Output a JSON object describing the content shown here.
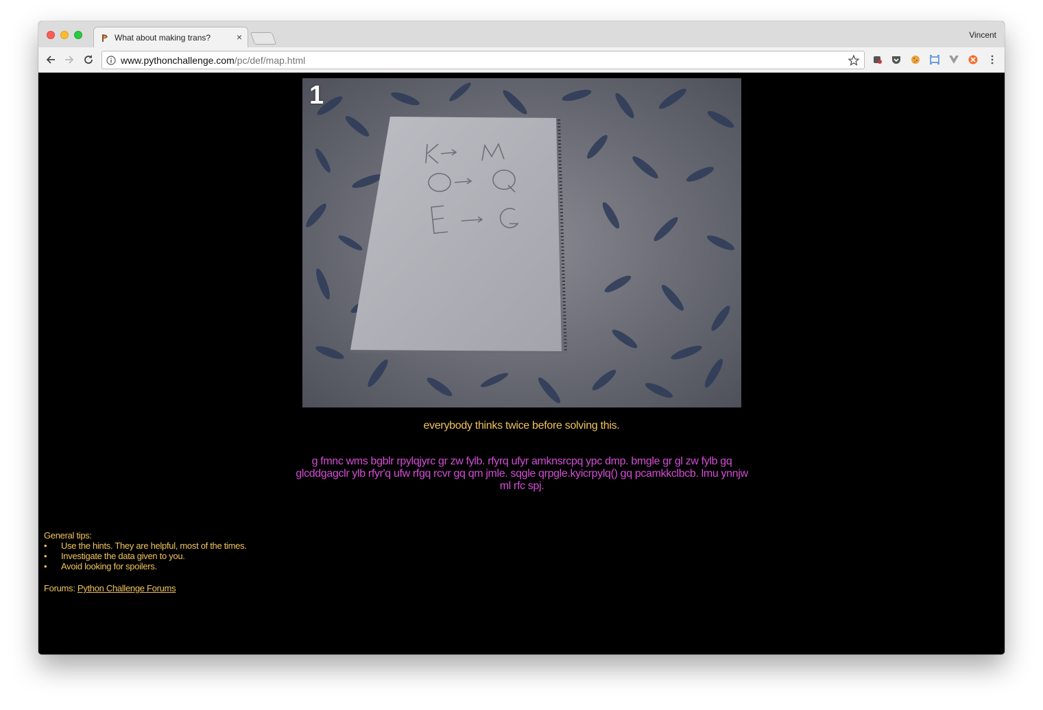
{
  "browser": {
    "tab_title": "What about making trans?",
    "tab_close": "×",
    "profile_name": "Vincent",
    "url_host": "www.pythonchallenge.com",
    "url_path": "/pc/def/map.html"
  },
  "page": {
    "image_label": "1",
    "hint": "everybody thinks twice before solving this.",
    "cipher_text": "g fmnc wms bgblr rpylqjyrc gr zw fylb. rfyrq ufyr amknsrcpq ypc dmp. bmgle gr gl zw fylb gq glcddgagclr ylb rfyr'q ufw rfgq rcvr gq qm jmle. sqgle qrpgle.kyicrpylq() gq pcamkkclbcb. lmu ynnjw ml rfc spj.",
    "tips_title": "General tips:",
    "tips": [
      "Use the hints. They are helpful, most of the times.",
      "Investigate the data given to you.",
      "Avoid looking for spoilers."
    ],
    "forums_label": "Forums: ",
    "forums_link": "Python Challenge Forums"
  },
  "colors": {
    "hint": "#f2c45c",
    "cipher": "#d64dd6",
    "background": "#000000"
  }
}
